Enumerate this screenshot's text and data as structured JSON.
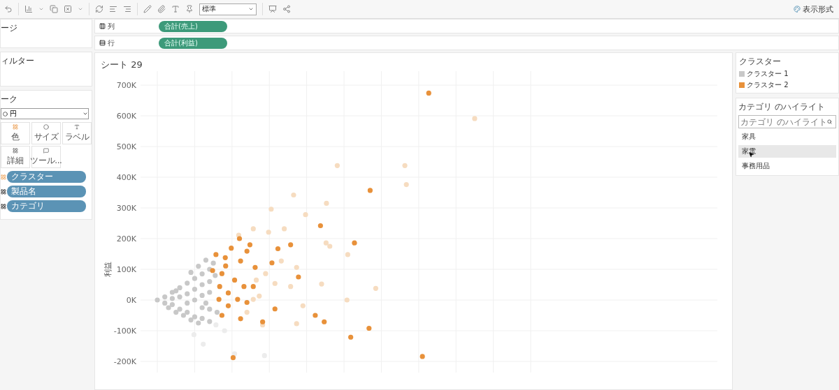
{
  "toolbar": {
    "fit_dropdown": "標準",
    "format_button": "表示形式"
  },
  "pages_card": {
    "title": "ージ"
  },
  "filters_card": {
    "title": "ィルター"
  },
  "marks_card": {
    "title": "ーク",
    "mark_type": "円",
    "buttons": [
      {
        "label": "色",
        "kind": "color"
      },
      {
        "label": "サイズ",
        "kind": "size"
      },
      {
        "label": "ラベル",
        "kind": "label"
      },
      {
        "label": "詳細",
        "kind": "detail"
      },
      {
        "label": "ツール...",
        "kind": "tooltip"
      }
    ],
    "fields": [
      {
        "label": "クラスター",
        "kind": "color"
      },
      {
        "label": "製品名",
        "kind": "detail"
      },
      {
        "label": "カテゴリ",
        "kind": "detail"
      }
    ]
  },
  "shelves": [
    {
      "label": "列",
      "kind": "columns",
      "pill": {
        "label": "合計(売上)",
        "kind": "measure"
      }
    },
    {
      "label": "行",
      "kind": "rows",
      "pill": {
        "label": "合計(利益)",
        "kind": "measure"
      }
    }
  ],
  "sheet": {
    "title": "シート 29",
    "y_axis": {
      "title": "利益",
      "ticks": [
        "700K",
        "600K",
        "500K",
        "400K",
        "300K",
        "200K",
        "100K",
        "0K",
        "-100K",
        "-200K"
      ]
    }
  },
  "legend": {
    "title": "クラスター",
    "items": [
      {
        "label": "クラスター 1",
        "color": "#c8c8c8"
      },
      {
        "label": "クラスター 2",
        "color": "#e8913a"
      }
    ]
  },
  "highlighter": {
    "title": "カテゴリ のハイライト",
    "placeholder": "カテゴリ のハイライト",
    "items": [
      {
        "label": "家具",
        "selected": false
      },
      {
        "label": "家電",
        "selected": true
      },
      {
        "label": "事務用品",
        "selected": false
      }
    ]
  }
}
